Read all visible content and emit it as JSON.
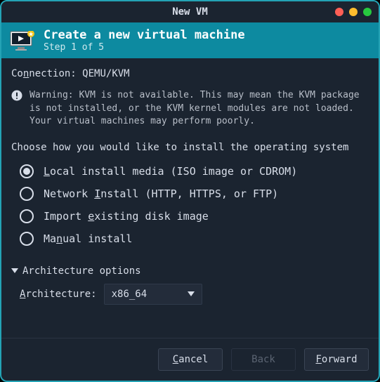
{
  "window": {
    "title": "New VM"
  },
  "header": {
    "title": "Create a new virtual machine",
    "step": "Step 1 of 5"
  },
  "connection": {
    "label_prefix": "Co",
    "label_u": "n",
    "label_suffix": "nection:",
    "value": "QEMU/KVM"
  },
  "warning": {
    "text": "Warning: KVM is not available. This may mean the KVM package is not installed, or the KVM kernel modules are not loaded. Your virtual machines may perform poorly."
  },
  "install": {
    "choose_label": "Choose how you would like to install the operating system",
    "options": [
      {
        "id": "local",
        "selected": true,
        "pre": "",
        "u": "L",
        "post": "ocal install media (ISO image or CDROM)"
      },
      {
        "id": "net",
        "selected": false,
        "pre": "Network ",
        "u": "I",
        "post": "nstall (HTTP, HTTPS, or FTP)"
      },
      {
        "id": "import",
        "selected": false,
        "pre": "Import ",
        "u": "e",
        "post": "xisting disk image"
      },
      {
        "id": "manual",
        "selected": false,
        "pre": "Ma",
        "u": "n",
        "post": "ual install"
      }
    ]
  },
  "arch": {
    "toggle_label": "Architecture options",
    "label_u": "A",
    "label_rest": "rchitecture:",
    "value": "x86_64"
  },
  "buttons": {
    "cancel_u": "C",
    "cancel_rest": "ancel",
    "back": "Back",
    "forward_u": "F",
    "forward_rest": "orward"
  }
}
